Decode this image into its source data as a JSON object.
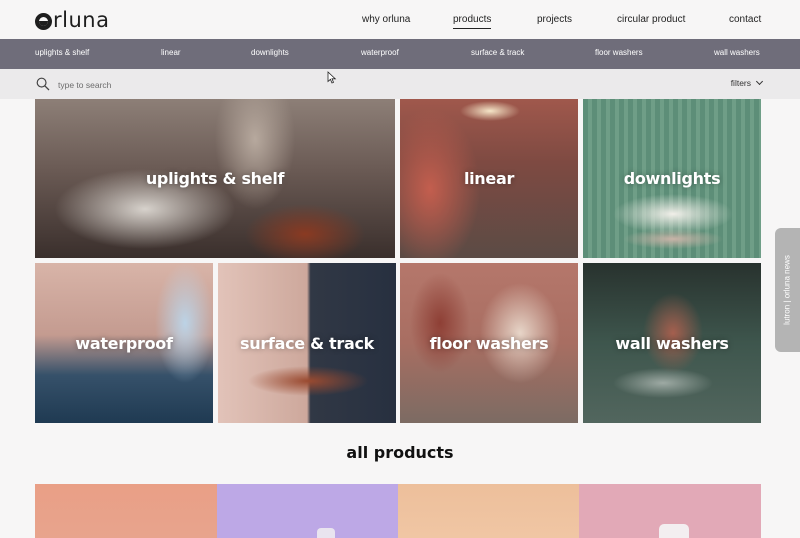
{
  "brand": {
    "logo_text": "rluna"
  },
  "nav": [
    {
      "label": "why orluna"
    },
    {
      "label": "products",
      "active": true
    },
    {
      "label": "projects"
    },
    {
      "label": "circular product"
    },
    {
      "label": "contact"
    }
  ],
  "categories": [
    {
      "label": "uplights & shelf"
    },
    {
      "label": "linear"
    },
    {
      "label": "downlights"
    },
    {
      "label": "waterproof"
    },
    {
      "label": "surface & track"
    },
    {
      "label": "floor washers"
    },
    {
      "label": "wall washers"
    }
  ],
  "search": {
    "placeholder": "type to search",
    "icon": "search-icon"
  },
  "filters": {
    "label": "filters",
    "icon": "chevron-down-icon"
  },
  "tiles": [
    {
      "label": "uplights & shelf"
    },
    {
      "label": "linear"
    },
    {
      "label": "downlights"
    },
    {
      "label": "waterproof"
    },
    {
      "label": "surface & track"
    },
    {
      "label": "floor washers"
    },
    {
      "label": "wall washers"
    }
  ],
  "side_tab": {
    "label": "lutron | orluna news"
  },
  "all_products": {
    "title": "all products"
  },
  "colors": {
    "category_bar": "#6f6d7a",
    "search_bar": "#ebeaeb",
    "page_bg": "#f7f6f6",
    "side_tab": "#b4b4b4"
  }
}
